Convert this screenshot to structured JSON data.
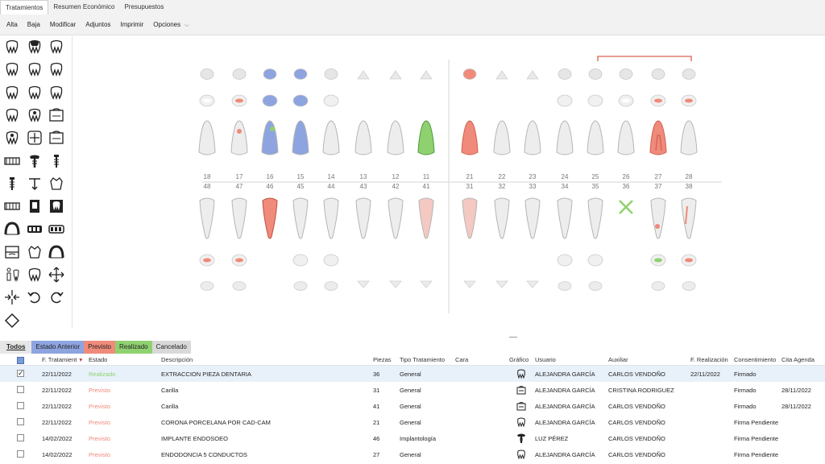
{
  "tabs": [
    "Tratamientos",
    "Resumen Económico",
    "Presupuestos"
  ],
  "toolbar": {
    "alta": "Alta",
    "baja": "Baja",
    "modificar": "Modificar",
    "adjuntos": "Adjuntos",
    "imprimir": "Imprimir",
    "opciones": "Opciones"
  },
  "upper_numbers": [
    "18",
    "17",
    "16",
    "15",
    "14",
    "13",
    "12",
    "11",
    "21",
    "22",
    "23",
    "24",
    "25",
    "26",
    "27",
    "28"
  ],
  "lower_numbers": [
    "48",
    "47",
    "46",
    "45",
    "44",
    "43",
    "42",
    "41",
    "31",
    "32",
    "33",
    "34",
    "35",
    "36",
    "37",
    "38"
  ],
  "filters": {
    "todos": "Todos",
    "anterior": "Estado Anterior",
    "previsto": "Previsto",
    "realizado": "Realizado",
    "cancelado": "Cancelado"
  },
  "colors": {
    "anterior": "#8ea4e0",
    "previsto": "#f08a7a",
    "realizado": "#8fd16f",
    "cancelado": "#d9d9d9",
    "selected_row": "#e8f1fa"
  },
  "columns": {
    "fecha": "F. Tratamient",
    "estado": "Estado",
    "descripcion": "Descripción",
    "piezas": "Piezas",
    "tipo": "Tipo Tratamiento",
    "cara": "Cara",
    "grafico": "Gráfico",
    "usuario": "Usuario",
    "auxiliar": "Auxiliar",
    "realizacion": "F. Realización",
    "consentimiento": "Consentimiento",
    "cita": "Cita Agenda"
  },
  "rows": [
    {
      "fecha": "22/11/2022",
      "estado": "Realizado",
      "descripcion": "EXTRACCION PIEZA DENTARIA",
      "pieza": "36",
      "tipo": "General",
      "usuario": "ALEJANDRA GARCÍA",
      "auxiliar": "CARLOS VENDOÑO",
      "realizacion": "22/11/2022",
      "consentimiento": "Firmado",
      "cita": "",
      "checked": true,
      "icon": "tooth-icon"
    },
    {
      "fecha": "22/11/2022",
      "estado": "Previsto",
      "descripcion": "Carilla",
      "pieza": "31",
      "tipo": "General",
      "usuario": "ALEJANDRA GARCÍA",
      "auxiliar": "CRISTINA RODRIGUEZ",
      "realizacion": "",
      "consentimiento": "Firmado",
      "cita": "28/11/2022",
      "checked": false,
      "icon": "veneer-icon"
    },
    {
      "fecha": "22/11/2022",
      "estado": "Previsto",
      "descripcion": "Carilla",
      "pieza": "41",
      "tipo": "General",
      "usuario": "ALEJANDRA GARCÍA",
      "auxiliar": "CARLOS VENDOÑO",
      "realizacion": "",
      "consentimiento": "Firmado",
      "cita": "28/11/2022",
      "checked": false,
      "icon": "veneer-icon"
    },
    {
      "fecha": "22/11/2022",
      "estado": "Previsto",
      "descripcion": "CORONA PORCELANA POR CAD-CAM",
      "pieza": "21",
      "tipo": "General",
      "usuario": "ALEJANDRA GARCÍA",
      "auxiliar": "CARLOS VENDOÑO",
      "realizacion": "",
      "consentimiento": "Firma Pendiente",
      "cita": "",
      "checked": false,
      "icon": "tooth-icon"
    },
    {
      "fecha": "14/02/2022",
      "estado": "Previsto",
      "descripcion": "IMPLANTE ENDOSOEO",
      "pieza": "46",
      "tipo": "Implantología",
      "usuario": "LUZ PÉREZ",
      "auxiliar": "CARLOS VENDOÑO",
      "realizacion": "",
      "consentimiento": "Firma Pendiente",
      "cita": "",
      "checked": false,
      "icon": "implant-icon"
    },
    {
      "fecha": "14/02/2022",
      "estado": "Previsto",
      "descripcion": "ENDODONCIA 5 CONDUCTOS",
      "pieza": "27",
      "tipo": "General",
      "usuario": "ALEJANDRA GARCÍA",
      "auxiliar": "CARLOS VENDOÑO",
      "realizacion": "",
      "consentimiento": "Firma Pendiente",
      "cita": "",
      "checked": false,
      "icon": "tooth-icon"
    }
  ]
}
